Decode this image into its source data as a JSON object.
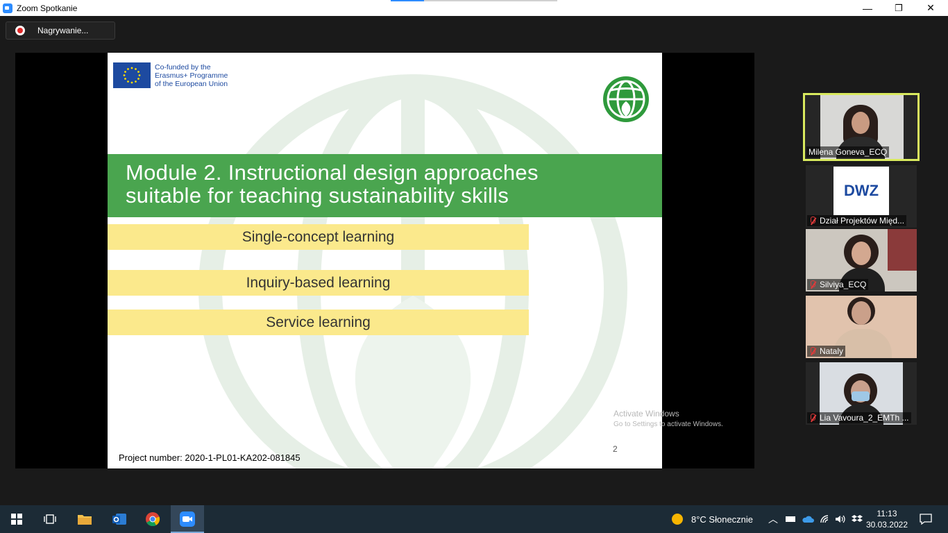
{
  "window": {
    "title": "Zoom Spotkanie",
    "minimize_glyph": "—",
    "maximize_glyph": "❐",
    "close_glyph": "✕"
  },
  "recording": {
    "label": "Nagrywanie..."
  },
  "slide": {
    "eu_text_line1": "Co-funded by the",
    "eu_text_line2": "Erasmus+ Programme",
    "eu_text_line3": "of the European Union",
    "module_line1": "Module 2. Instructional design approaches",
    "module_line2": "suitable for teaching sustainability skills",
    "items": [
      "Single-concept learning",
      "Inquiry-based learning",
      "Service learning"
    ],
    "project_number": "Project number: 2020-1-PL01-KA202-081845",
    "page_number": "2",
    "colors": {
      "green": "#4aa54f",
      "yellow": "#fbe98c",
      "eu_blue": "#1d4aa0"
    }
  },
  "activation": {
    "line1": "Activate Windows",
    "line2": "Go to Settings to activate Windows."
  },
  "participants": [
    {
      "name": "Milena Goneva_ECQ",
      "muted": false,
      "active": true
    },
    {
      "name": "Dział Projektów Międ...",
      "muted": true,
      "active": false,
      "logo_text": "DWZ"
    },
    {
      "name": "Silviya_ECQ",
      "muted": true,
      "active": false
    },
    {
      "name": "Nataly",
      "muted": true,
      "active": false
    },
    {
      "name": "Lia Vavoura_2_EMTh ...",
      "muted": true,
      "active": false
    }
  ],
  "taskbar": {
    "apps": [
      "windows-start",
      "task-view",
      "file-explorer",
      "outlook",
      "chrome",
      "zoom"
    ],
    "weather": "8°C  Słonecznie",
    "time": "11:13",
    "date": "30.03.2022"
  }
}
